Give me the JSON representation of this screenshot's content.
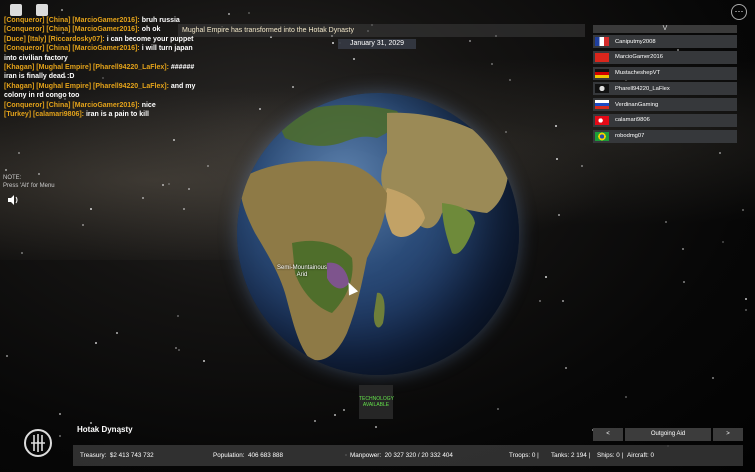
{
  "top": {
    "announcement": "Mughal Empire has transformed into the Hotak Dynasty",
    "date": "January 31, 2029",
    "menu_glyph": "⋯"
  },
  "chat": [
    {
      "prefix": "[Conqueror] [China] [MarcioGamer2016]:",
      "message": "bruh russia",
      "name_color": "#b9b9b9"
    },
    {
      "prefix": "[Conqueror] [China] [MarcioGamer2016]:",
      "message": "oh ok",
      "name_color": "#b9b9b9"
    },
    {
      "prefix": "[Duce] [Italy] [Riccardosky07]:",
      "message": "i can become your puppet",
      "name_color": "#7aa7e8"
    },
    {
      "prefix": "[Conqueror] [China] [MarcioGamer2016]:",
      "message": "i will turn japan",
      "name_color": "#b9b9b9"
    },
    {
      "prefix": "",
      "message": "into civilian factory",
      "name_color": "#ffffff"
    },
    {
      "prefix": "[Khagan] [Mughal Empire] [Pharell94220_LaFlex]:",
      "message": "######",
      "name_color": "#6fd16f"
    },
    {
      "prefix": "",
      "message": "iran is finally dead :D",
      "name_color": "#ffffff"
    },
    {
      "prefix": "[Khagan] [Mughal Empire] [Pharell94220_LaFlex]:",
      "message": "and my",
      "name_color": "#6fd16f"
    },
    {
      "prefix": "",
      "message": "colony in rd congo too",
      "name_color": "#ffffff"
    },
    {
      "prefix": "[Conqueror] [China] [MarcioGamer2016]:",
      "message": "nice",
      "name_color": "#b9b9b9"
    },
    {
      "prefix": "[Turkey] [calamari9806]:",
      "message": "iran is a pain to kill",
      "name_color": "#7aa7e8"
    }
  ],
  "note": {
    "line1": "NOTE:",
    "line2": "Press 'Alt' for Menu"
  },
  "map": {
    "region_label": "Semi-Mountainous Arid"
  },
  "players": {
    "toggle": "V",
    "list": [
      {
        "name": "Caniputmy2008",
        "flag": "france"
      },
      {
        "name": "MarcioGamer2016",
        "flag": "china"
      },
      {
        "name": "MustacheshepVT",
        "flag": "germany"
      },
      {
        "name": "Pharell94220_LaFlex",
        "flag": "mughal"
      },
      {
        "name": "VerdinanGaming",
        "flag": "russia"
      },
      {
        "name": "calamari9806",
        "flag": "turkey"
      },
      {
        "name": "robodmg07",
        "flag": "brazil"
      }
    ]
  },
  "tech": {
    "label": "TECHNOLOGY AVAILABLE"
  },
  "country": {
    "name": "Hotak Dynasty"
  },
  "aid": {
    "prev": "<",
    "label": "Outgoing Aid",
    "next": ">"
  },
  "stats": {
    "treasury_label": "Treasury:",
    "treasury": "$2 413 743 732",
    "population_label": "Population:",
    "population": "406 683 888",
    "manpower_label": "Manpower:",
    "manpower": "20 327 320  /  20 332 404",
    "troops_label": "Troops:",
    "troops": "0",
    "tanks_label": "Tanks:",
    "tanks": "2 194",
    "ships_label": "Ships:",
    "ships": "0",
    "aircraft_label": "Aircraft:",
    "aircraft": "0"
  },
  "colors": {
    "chat_prefix": "#e3a21a",
    "tech_text": "#63e04a",
    "panel": "#36383b"
  }
}
